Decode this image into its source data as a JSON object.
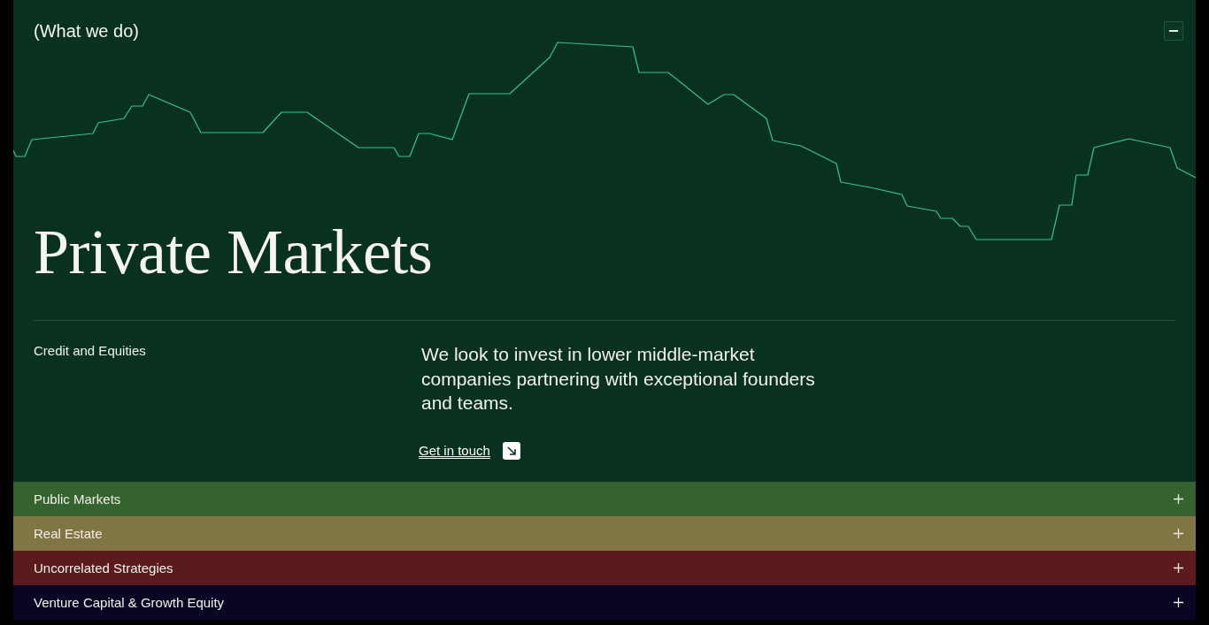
{
  "section_label": "(What we do)",
  "sectors": [
    {
      "title": "Private Markets",
      "expanded": true,
      "color": "#08311f",
      "subtitle": "Credit and Equities",
      "description": "We look to invest in lower middle-market companies partnering with exceptional founders and teams.",
      "link": "Get in touch"
    },
    {
      "title": "Public Markets",
      "expanded": false,
      "color": "#35632f"
    },
    {
      "title": "Real Estate",
      "expanded": false,
      "color": "#827544"
    },
    {
      "title": "Uncorrelated Strategies",
      "expanded": false,
      "color": "#5b1b1e"
    },
    {
      "title": "Venture Capital & Growth Equity",
      "expanded": false,
      "color": "#0a0523"
    }
  ]
}
